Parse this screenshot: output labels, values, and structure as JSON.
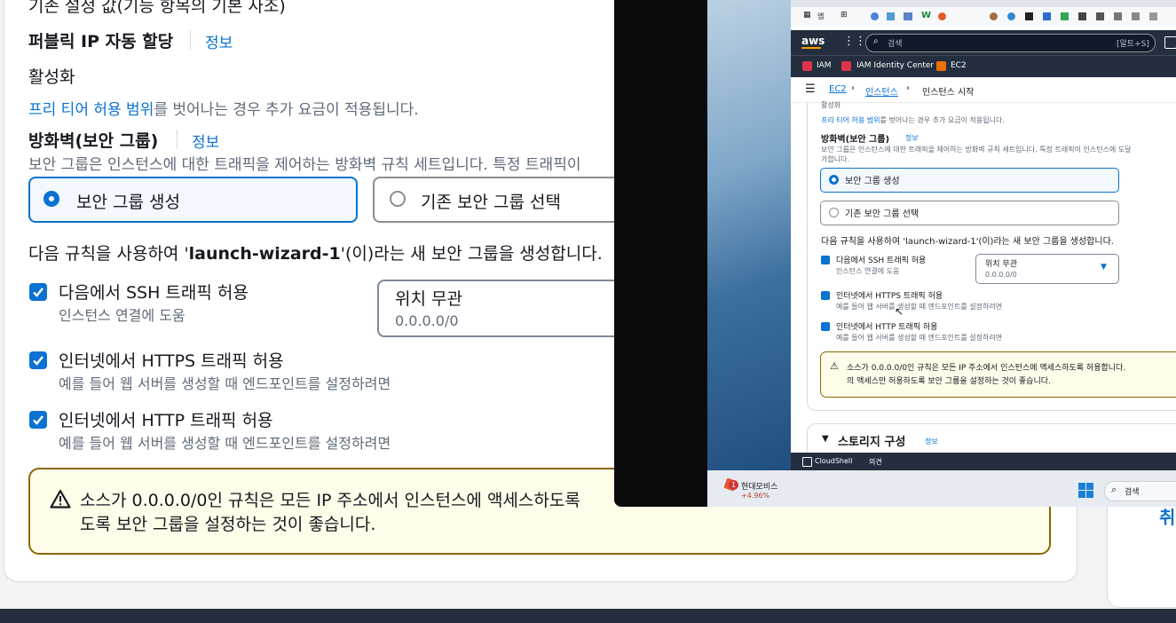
{
  "main": {
    "top_text": "기존 설정 값(기능 항목의 기본 사조)",
    "public_ip": {
      "label": "퍼블릭 IP 자동 할당",
      "info": "정보",
      "value": "활성화"
    },
    "free_tier": {
      "link": "프리 티어 허용 범위",
      "rest": "를 벗어나는 경우 추가 요금이 적용됩니다."
    },
    "firewall": {
      "label": "방화벽(보안 그룹)",
      "info": "정보",
      "desc": "보안 그룹은 인스턴스에 대한 트래픽을 제어하는 방화벽 규칙 세트입니다. 특정 트래픽이",
      "option_create": "보안 그룹 생성",
      "option_existing": "기존 보안 그룹 선택"
    },
    "rule_sentence": {
      "pre": "다음 규칙을 사용하여 '",
      "name": "launch-wizard-1",
      "post": "'(이)라는 새 보안 그룹을 생성합니다."
    },
    "rules": [
      {
        "title": "다음에서 SSH 트래픽 허용",
        "desc": "인스턴스 연결에 도움",
        "checked": true
      },
      {
        "title": "인터넷에서 HTTPS 트래픽 허용",
        "desc": "예를 들어 웹 서버를 생성할 때 엔드포인트를 설정하려면",
        "checked": true
      },
      {
        "title": "인터넷에서 HTTP 트래픽 허용",
        "desc": "예를 들어 웹 서버를 생성할 때 엔드포인트를 설정하려면",
        "checked": true
      }
    ],
    "ssh_source": {
      "value": "위치 무관",
      "sub": "0.0.0.0/0"
    },
    "warning": {
      "line1": "소스가 0.0.0.0/0인 규칙은 모든 IP 주소에서 인스턴스에 액세스하도록",
      "line2": "도록 보안 그룹을 설정하는 것이 좋습니다."
    },
    "right_peek": "취"
  },
  "overlay": {
    "bookmark_text": "앱",
    "search_placeholder": "검색",
    "search_shortcut": "[알트+S]",
    "aws_logo": "aws",
    "favorites": [
      "IAM",
      "IAM Identity Center",
      "EC2"
    ],
    "breadcrumb": [
      "EC2",
      "인스턴스",
      "인스턴스 시작"
    ],
    "top_cut": "활성화",
    "free_tier": {
      "link": "프리 티어 허용 범위",
      "rest": "를 벗어나는 경우 추가 요금이 적용됩니다."
    },
    "firewall_label": "방화벽(보안 그룹)",
    "firewall_info": "정보",
    "firewall_desc1": "보안 그룹은 인스턴스에 대한 트래픽을 제어하는 방화벽 규칙 세트입니다. 특정 트래픽이 인스턴스에 도달",
    "firewall_desc2": "가합니다.",
    "option_create": "보안 그룹 생성",
    "option_existing": "기존 보안 그룹 선택",
    "rule_sentence": "다음 규칙을 사용하여 'launch-wizard-1'(이)라는 새 보안 그룹을 생성합니다.",
    "rules": [
      {
        "title": "다음에서 SSH 트래픽 허용",
        "desc": "인스턴스 연결에 도움"
      },
      {
        "title": "인터넷에서 HTTPS 트래픽 허용",
        "desc": "예를 들어 웹 서버를 생성할 때 엔드포인트를 설정하려면"
      },
      {
        "title": "인터넷에서 HTTP 트래픽 허용",
        "desc": "예를 들어 웹 서버를 생성할 때 엔드포인트를 설정하려면"
      }
    ],
    "ssh_source": {
      "value": "위치 무관",
      "sub": "0.0.0.0/0"
    },
    "warning": {
      "line1": "소스가 0.0.0.0/0인 규칙은 모든 IP 주소에서 인스턴스에 액세스하도록 허용합니다.",
      "line2": "의 액세스만 허용하도록 보안 그룹을 설정하는 것이 좋습니다."
    },
    "storage": {
      "label": "스토리지 구성",
      "info": "정보"
    },
    "footer": {
      "cloudshell": "CloudShell",
      "feedback": "의견"
    },
    "taskbar": {
      "stock_name": "현대모비스",
      "stock_change": "+4.96%",
      "badge": "1",
      "search": "검색"
    }
  },
  "colors": {
    "link": "#0972d3",
    "warning_border": "#8d6605",
    "warning_bg": "#fffce9",
    "aws_nav": "#232f3e",
    "aws_orange": "#ff9900"
  }
}
